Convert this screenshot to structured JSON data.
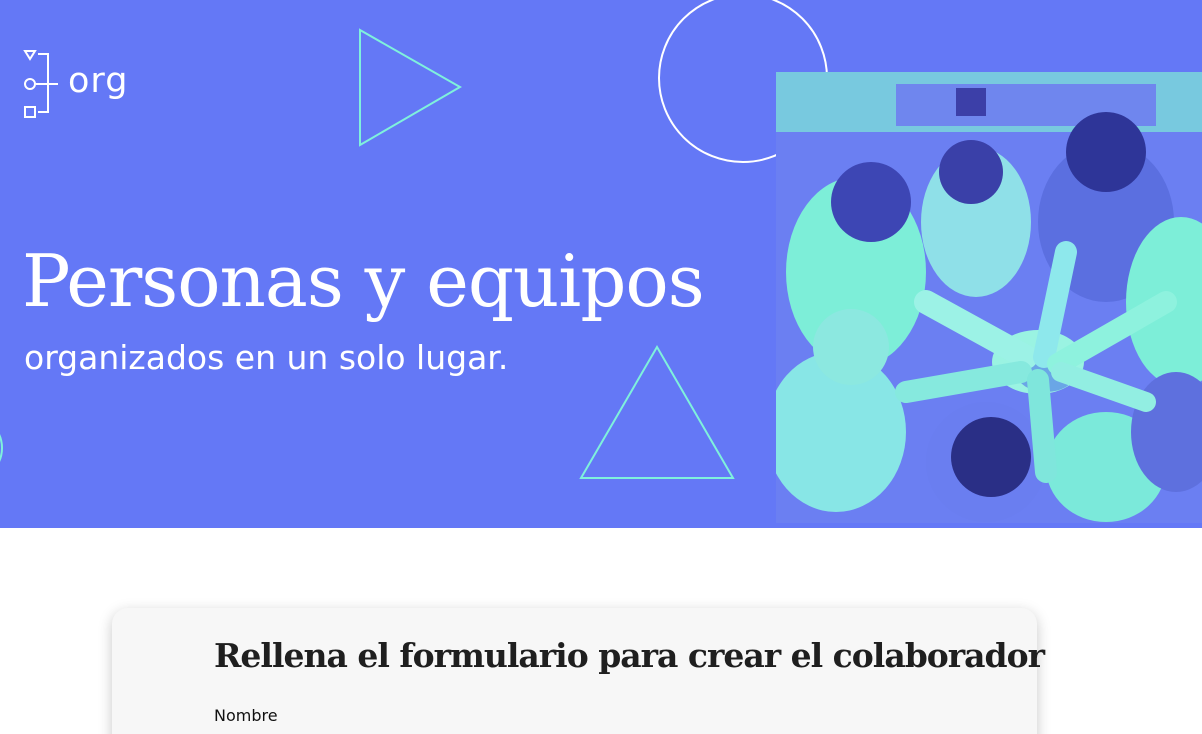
{
  "brand": {
    "logo_text": "org",
    "colors": {
      "hero_bg": "#6478f6",
      "accent_mint": "#7ff1dc",
      "white": "#ffffff"
    }
  },
  "hero": {
    "title": "Personas y equipos",
    "subtitle": "organizados en un solo lugar."
  },
  "photo": {
    "icon": "team-hands-photo"
  },
  "form": {
    "title": "Rellena el formulario para crear el colaborador",
    "fields": [
      {
        "label": "Nombre"
      }
    ]
  }
}
